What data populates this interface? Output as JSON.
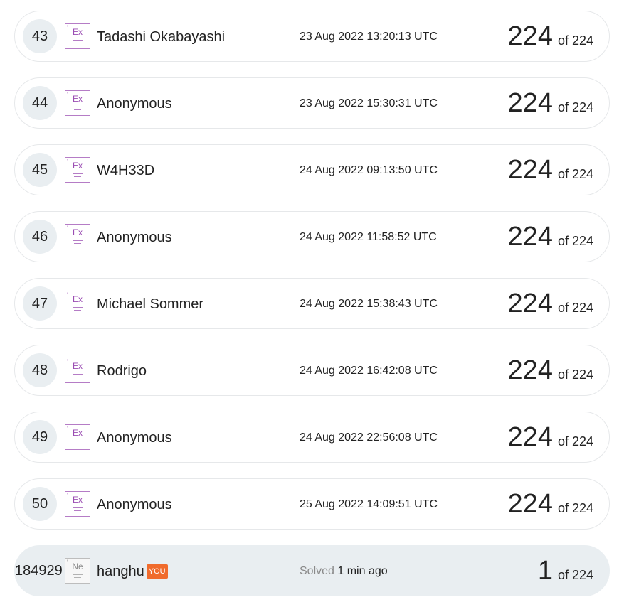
{
  "leaderboard": {
    "rows": [
      {
        "rank": "43",
        "badge_symbol": "Ex",
        "badge_mark": "'",
        "name": "Tadashi Okabayashi",
        "timestamp": "23 Aug 2022 13:20:13 UTC",
        "score": "224",
        "total": "of 224"
      },
      {
        "rank": "44",
        "badge_symbol": "Ex",
        "badge_mark": "'",
        "name": "Anonymous",
        "timestamp": "23 Aug 2022 15:30:31 UTC",
        "score": "224",
        "total": "of 224"
      },
      {
        "rank": "45",
        "badge_symbol": "Ex",
        "badge_mark": "'",
        "name": "W4H33D",
        "timestamp": "24 Aug 2022 09:13:50 UTC",
        "score": "224",
        "total": "of 224"
      },
      {
        "rank": "46",
        "badge_symbol": "Ex",
        "badge_mark": "'",
        "name": "Anonymous",
        "timestamp": "24 Aug 2022 11:58:52 UTC",
        "score": "224",
        "total": "of 224"
      },
      {
        "rank": "47",
        "badge_symbol": "Ex",
        "badge_mark": "'",
        "name": "Michael Sommer",
        "timestamp": "24 Aug 2022 15:38:43 UTC",
        "score": "224",
        "total": "of 224"
      },
      {
        "rank": "48",
        "badge_symbol": "Ex",
        "badge_mark": "'",
        "name": "Rodrigo",
        "timestamp": "24 Aug 2022 16:42:08 UTC",
        "score": "224",
        "total": "of 224"
      },
      {
        "rank": "49",
        "badge_symbol": "Ex",
        "badge_mark": "'",
        "name": "Anonymous",
        "timestamp": "24 Aug 2022 22:56:08 UTC",
        "score": "224",
        "total": "of 224"
      },
      {
        "rank": "50",
        "badge_symbol": "Ex",
        "badge_mark": "'",
        "name": "Anonymous",
        "timestamp": "25 Aug 2022 14:09:51 UTC",
        "score": "224",
        "total": "of 224"
      }
    ],
    "current_user": {
      "rank": "184929",
      "badge_symbol": "Ne",
      "badge_mark": "'",
      "name": "hanghu",
      "you_label": "YOU",
      "solved_label": "Solved",
      "solved_value": "1 min ago",
      "score": "1",
      "total": "of 224"
    },
    "colors": {
      "badge_purple": "#9b4db3",
      "badge_gray": "#8e8e8e",
      "you_badge": "#f06b2c",
      "current_row_bg": "#e9eef1"
    }
  }
}
